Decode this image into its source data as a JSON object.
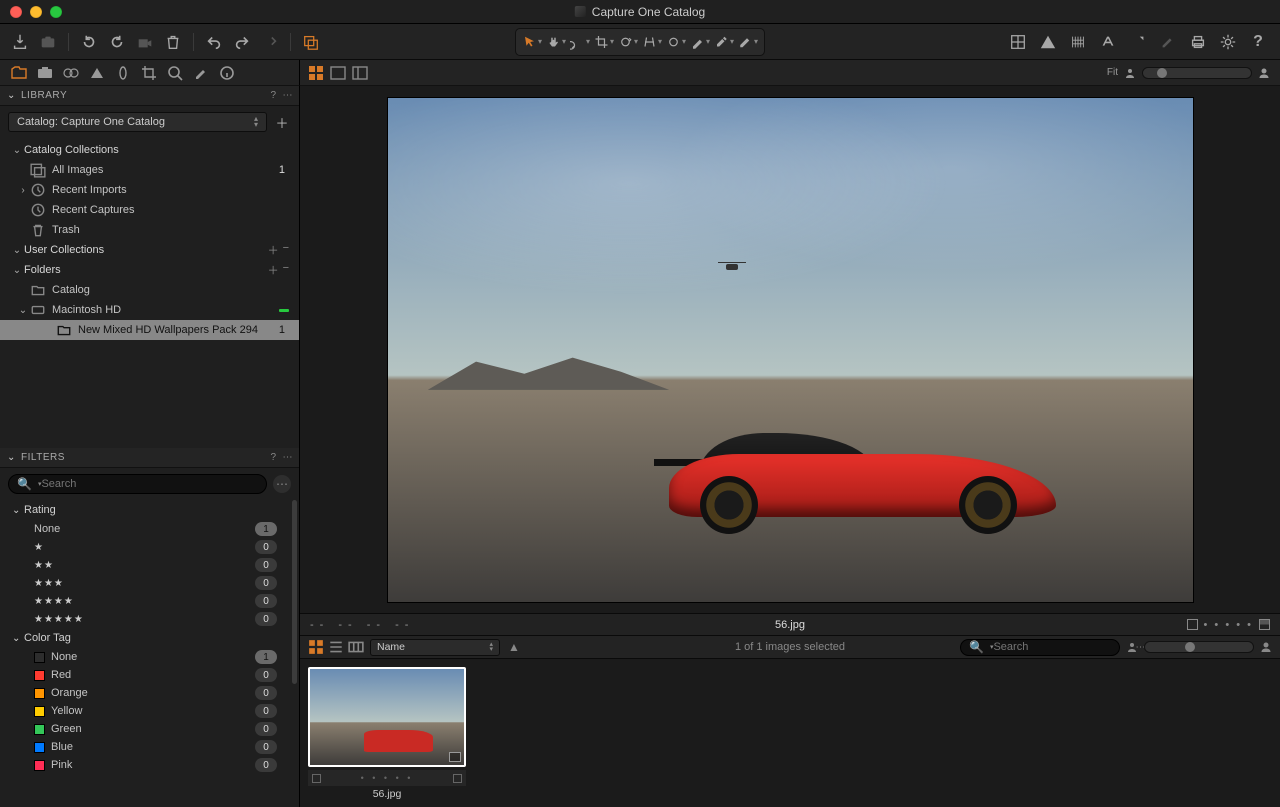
{
  "window_title": "Capture One Catalog",
  "viewer": {
    "fit_label": "Fit",
    "filename": "56.jpg",
    "info_dashes": "--   --   --   --"
  },
  "browser": {
    "sort_field": "Name",
    "selection_text": "1 of 1 images selected",
    "search_placeholder": "Search",
    "thumb_name": "56.jpg"
  },
  "library": {
    "panel_title": "Library",
    "catalog_selector": "Catalog: Capture One Catalog",
    "sections": {
      "catalog_collections": "Catalog Collections",
      "all_images": "All Images",
      "all_images_count": "1",
      "recent_imports": "Recent Imports",
      "recent_captures": "Recent Captures",
      "trash": "Trash",
      "user_collections": "User Collections",
      "folders": "Folders",
      "catalog": "Catalog",
      "macintosh_hd": "Macintosh HD",
      "selected_folder": "New Mixed HD Wallpapers Pack 294",
      "selected_count": "1"
    }
  },
  "filters": {
    "panel_title": "Filters",
    "search_placeholder": "Search",
    "rating_header": "Rating",
    "color_header": "Color Tag",
    "ratings": [
      {
        "label": "None",
        "count": "1",
        "one": true
      },
      {
        "stars": "★",
        "count": "0"
      },
      {
        "stars": "★★",
        "count": "0"
      },
      {
        "stars": "★★★",
        "count": "0"
      },
      {
        "stars": "★★★★",
        "count": "0"
      },
      {
        "stars": "★★★★★",
        "count": "0"
      }
    ],
    "colors": [
      {
        "name": "None",
        "cls": "sw-none",
        "count": "1",
        "one": true
      },
      {
        "name": "Red",
        "cls": "sw-red",
        "count": "0"
      },
      {
        "name": "Orange",
        "cls": "sw-orange",
        "count": "0"
      },
      {
        "name": "Yellow",
        "cls": "sw-yellow",
        "count": "0"
      },
      {
        "name": "Green",
        "cls": "sw-green",
        "count": "0"
      },
      {
        "name": "Blue",
        "cls": "sw-blue",
        "count": "0"
      },
      {
        "name": "Pink",
        "cls": "sw-pink",
        "count": "0"
      }
    ]
  }
}
